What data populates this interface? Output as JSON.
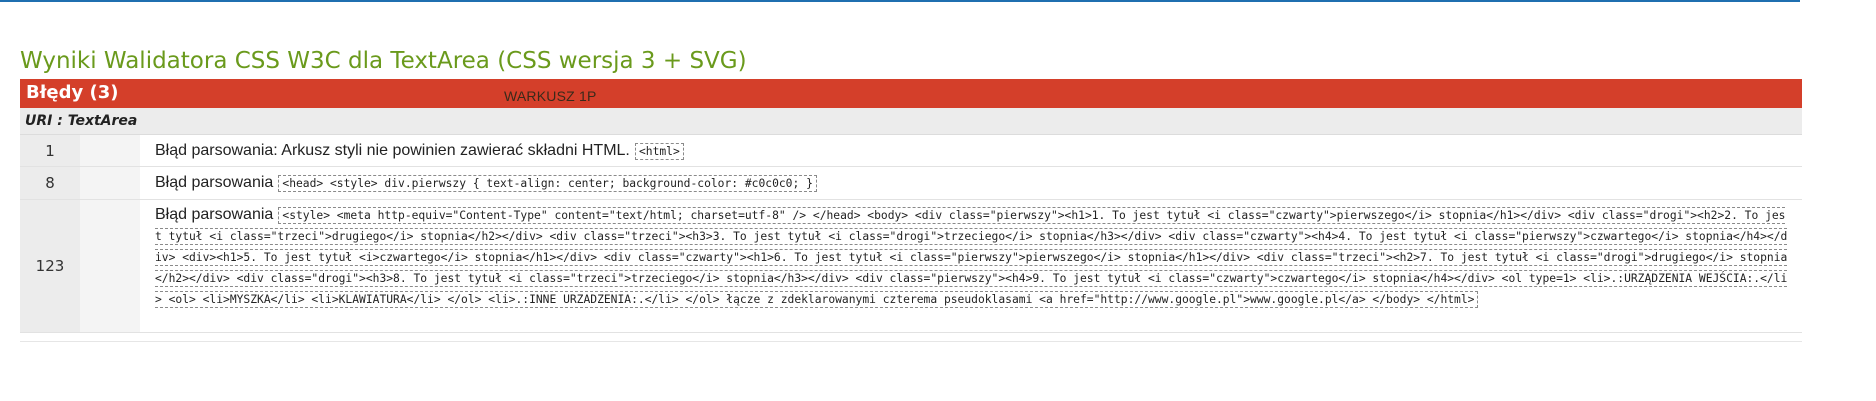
{
  "page": {
    "title": "Wyniki Walidatora CSS W3C dla TextArea (CSS wersja 3 + SVG)"
  },
  "errors": {
    "header": "Błędy (3)",
    "sheet_label": "WARKUSZ 1P",
    "uri_label": "URI : TextArea",
    "rows": [
      {
        "line": "1",
        "message": "Błąd parsowania: Arkusz styli nie powinien zawierać składni HTML.",
        "code": "<html>"
      },
      {
        "line": "8",
        "message": "Błąd parsowania",
        "code": "<head> <style> div.pierwszy { text-align: center; background-color: #c0c0c0; }"
      },
      {
        "line": "123",
        "message": "Błąd parsowania",
        "code": "<style> <meta http-equiv=\"Content-Type\" content=\"text/html; charset=utf-8\" /> </head> <body> <div class=\"pierwszy\"><h1>1. To jest tytuł <i class=\"czwarty\">pierwszego</i> stopnia</h1></div> <div class=\"drogi\"><h2>2. To jest tytuł <i class=\"trzeci\">drugiego</i> stopnia</h2></div> <div class=\"trzeci\"><h3>3. To jest tytuł <i class=\"drogi\">trzeciego</i> stopnia</h3></div> <div class=\"czwarty\"><h4>4. To jest tytuł <i class=\"pierwszy\">czwartego</i> stopnia</h4></div> <div><h1>5. To jest tytuł <i>czwartego</i> stopnia</h1></div> <div class=\"czwarty\"><h1>6. To jest tytuł <i class=\"pierwszy\">pierwszego</i> stopnia</h1></div> <div class=\"trzeci\"><h2>7. To jest tytuł <i class=\"drogi\">drugiego</i> stopnia</h2></div> <div class=\"drogi\"><h3>8. To jest tytuł <i class=\"trzeci\">trzeciego</i> stopnia</h3></div> <div class=\"pierwszy\"><h4>9. To jest tytuł <i class=\"czwarty\">czwartego</i> stopnia</h4></div> <ol type=1> <li>.:URZĄDZENIA WEJŚCIA:.</li> <ol> <li>MYSZKA</li> <li>KLAWIATURA</li> </ol> <li>.:INNE URZADZENIA:.</li> </ol> łącze z zdeklarowanymi czterema pseudoklasami <a href=\"http://www.google.pl\">www.google.pl</a> </body> </html>"
      }
    ]
  },
  "colors": {
    "title_green": "#6a9a1c",
    "header_red": "#d43f2a",
    "top_rule_blue": "#1f6fb0"
  }
}
